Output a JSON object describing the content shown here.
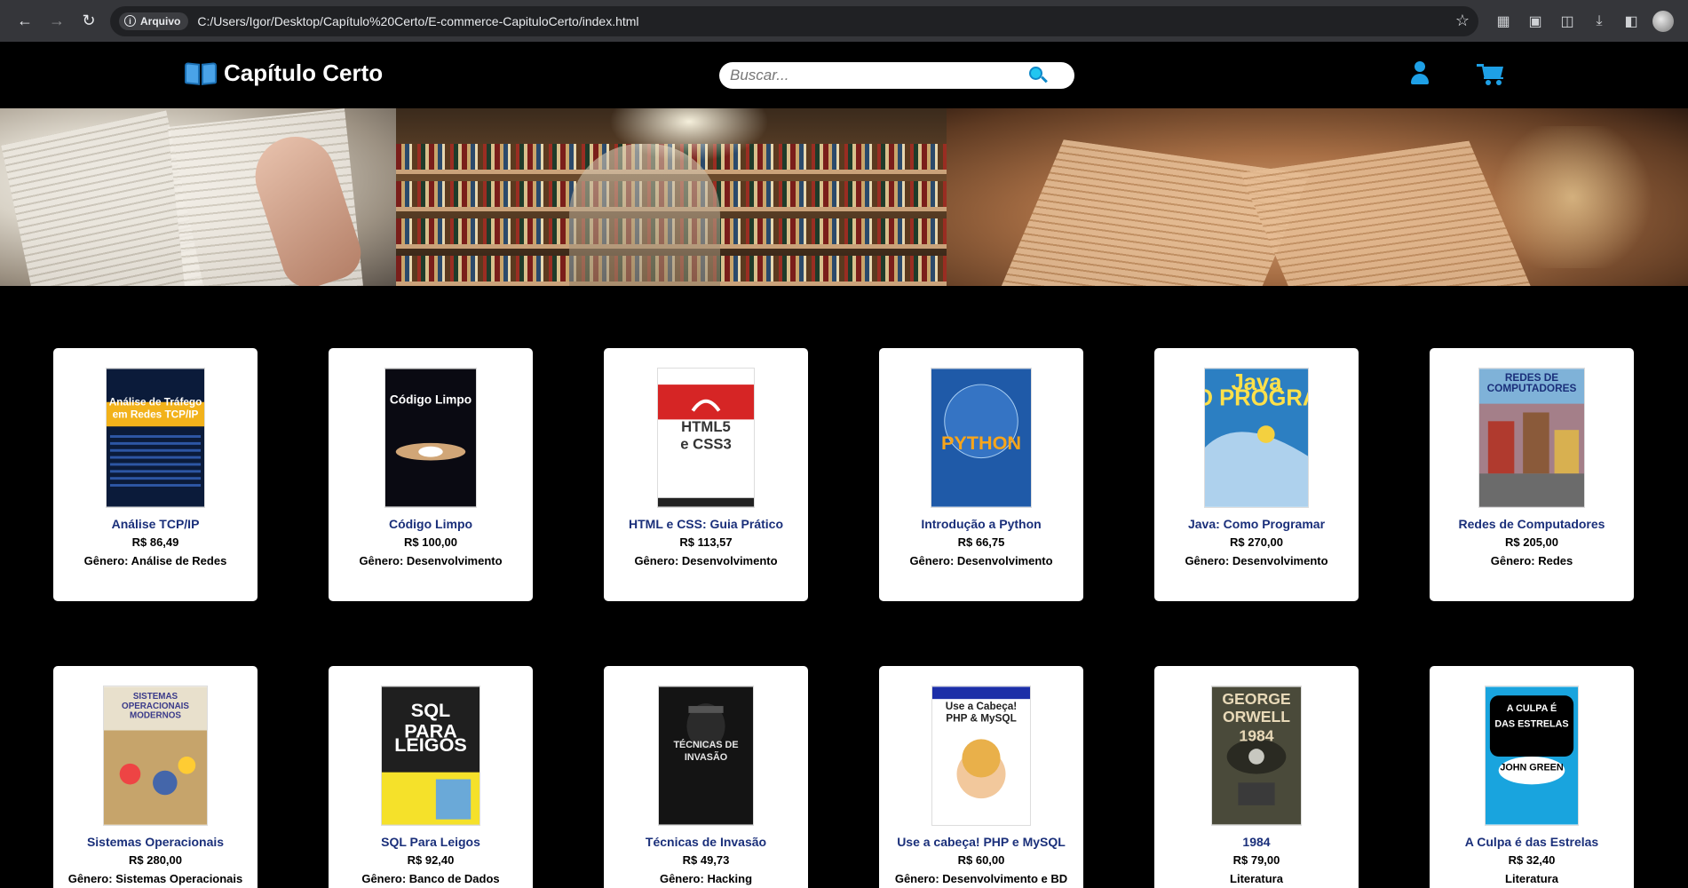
{
  "browser": {
    "site_chip": "Arquivo",
    "url": "C:/Users/Igor/Desktop/Capítulo%20Certo/E-commerce-CapituloCerto/index.html"
  },
  "header": {
    "brand": "Capítulo Certo",
    "search_placeholder": "Buscar..."
  },
  "colors": {
    "accent": "#1ea0e6",
    "title_text": "#1a2f7a",
    "background": "#000000"
  },
  "products": [
    {
      "title": "Análise TCP/IP",
      "price": "R$ 86,49",
      "genre_label": "Gênero:",
      "genre": "Análise de Redes",
      "cover_text": [
        "Análise de Tráfego",
        "em Redes TCP/IP"
      ]
    },
    {
      "title": "Código Limpo",
      "price": "R$ 100,00",
      "genre_label": "Gênero:",
      "genre": "Desenvolvimento",
      "cover_text": [
        "Código Limpo"
      ]
    },
    {
      "title": "HTML e CSS: Guia Prático",
      "price": "R$ 113,57",
      "genre_label": "Gênero:",
      "genre": "Desenvolvimento",
      "cover_text": [
        "HTML5",
        "e CSS3"
      ]
    },
    {
      "title": "Introdução a Python",
      "price": "R$ 66,75",
      "genre_label": "Gênero:",
      "genre": "Desenvolvimento",
      "cover_text": [
        "PYTHON"
      ]
    },
    {
      "title": "Java: Como Programar",
      "price": "R$ 270,00",
      "genre_label": "Gênero:",
      "genre": "Desenvolvimento",
      "cover_text": [
        "Java",
        "COMO PROGRAMAR"
      ]
    },
    {
      "title": "Redes de Computadores",
      "price": "R$ 205,00",
      "genre_label": "Gênero:",
      "genre": "Redes",
      "cover_text": [
        "REDES DE",
        "COMPUTADORES"
      ]
    },
    {
      "title": "Sistemas Operacionais",
      "price": "R$ 280,00",
      "genre_label": "Gênero:",
      "genre": "Sistemas Operacionais",
      "cover_text": [
        "SISTEMAS",
        "OPERACIONAIS",
        "MODERNOS"
      ]
    },
    {
      "title": "SQL Para Leigos",
      "price": "R$ 92,40",
      "genre_label": "Gênero:",
      "genre": "Banco de Dados",
      "cover_text": [
        "SQL",
        "PARA",
        "LEIGOS"
      ]
    },
    {
      "title": "Técnicas de Invasão",
      "price": "R$ 49,73",
      "genre_label": "Gênero:",
      "genre": "Hacking",
      "cover_text": [
        "TÉCNICAS DE",
        "INVASÃO"
      ]
    },
    {
      "title": "Use a cabeça! PHP e MySQL",
      "price": "R$ 60,00",
      "genre_label": "Gênero:",
      "genre": "Desenvolvimento e BD",
      "cover_text": [
        "Use a Cabeça!",
        "PHP & MySQL"
      ]
    },
    {
      "title": "1984",
      "price": "R$ 79,00",
      "genre_label": "",
      "genre": "Literatura",
      "cover_text": [
        "GEORGE",
        "ORWELL",
        "1984"
      ]
    },
    {
      "title": "A Culpa é das Estrelas",
      "price": "R$ 32,40",
      "genre_label": "",
      "genre": "Literatura",
      "cover_text": [
        "A CULPA É",
        "DAS ESTRELAS",
        "JOHN GREEN"
      ]
    }
  ]
}
